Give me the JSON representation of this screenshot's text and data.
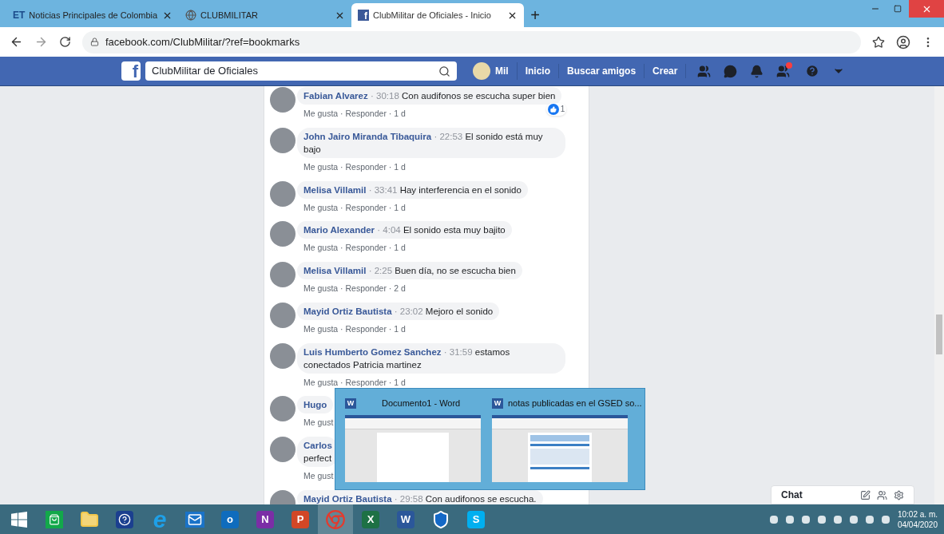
{
  "browser": {
    "tabs": [
      {
        "kind": "letters",
        "favicon": "ET",
        "title": "Noticias Principales de Colombia",
        "selected": false
      },
      {
        "kind": "globe",
        "title": "CLUBMILITAR",
        "selected": false
      },
      {
        "kind": "facebook",
        "favicon": "f",
        "title": "ClubMilitar de Oficiales - Inicio",
        "selected": true
      }
    ],
    "new_tab": "+",
    "address": "facebook.com/ClubMilitar/?ref=bookmarks"
  },
  "facebook_bar": {
    "logo": "f",
    "search": "ClubMilitar de Oficiales",
    "profile": "Mil",
    "links": [
      "Inicio",
      "Buscar amigos",
      "Crear"
    ]
  },
  "comments": [
    {
      "author": "Fabian Alvarez",
      "separator": "·",
      "time": "30:18",
      "text": "Con audifonos se escucha super bien",
      "actions": "Me gusta · Responder · 1 d",
      "likes": "1"
    },
    {
      "author": "John Jairo Miranda Tibaquira",
      "separator": "·",
      "time": "22:53",
      "text": "El sonido está muy bajo",
      "actions": "Me gusta · Responder · 1 d"
    },
    {
      "author": "Melisa Villamil",
      "separator": "·",
      "time": "33:41",
      "text": "Hay interferencia en el sonido",
      "actions": "Me gusta · Responder · 1 d"
    },
    {
      "author": "Mario Alexander",
      "separator": "·",
      "time": "4:04",
      "text": "El sonido esta muy bajito",
      "actions": "Me gusta · Responder · 1 d"
    },
    {
      "author": "Melisa Villamil",
      "separator": "·",
      "time": "2:25",
      "text": "Buen día, no se escucha bien",
      "actions": "Me gusta · Responder · 2 d"
    },
    {
      "author": "Mayid Ortiz Bautista",
      "separator": "·",
      "time": "23:02",
      "text": "Mejoro el sonido",
      "actions": "Me gusta · Responder · 1 d"
    },
    {
      "author": "Luis Humberto Gomez Sanchez",
      "separator": "·",
      "time": "31:59",
      "text": "estamos conectados Patricia martinez",
      "actions": "Me gusta · Responder · 1 d"
    },
    {
      "author": "Hugo",
      "actions": "Me gust"
    },
    {
      "author": "Carlos",
      "text": "perfect",
      "actions": "Me gust"
    },
    {
      "author": "Mayid Ortiz Bautista",
      "separator": "·",
      "time": "29:58",
      "text": "Con audifonos se escucha."
    }
  ],
  "task_preview": [
    {
      "app": "W",
      "title": "Documento1 - Word",
      "kind": "blank"
    },
    {
      "app": "W",
      "title": "notas publicadas en el GSED so...",
      "kind": "document"
    }
  ],
  "chat": {
    "label": "Chat"
  },
  "taskbar": {
    "apps": [
      {
        "kind": "windows"
      },
      {
        "kind": "store"
      },
      {
        "kind": "folder"
      },
      {
        "kind": "help"
      },
      {
        "kind": "ie",
        "letter": "e"
      },
      {
        "kind": "mail"
      },
      {
        "kind": "letter",
        "letter": "o",
        "color": "#0f6cbd"
      },
      {
        "kind": "letter",
        "letter": "N",
        "color": "#7b2ea6"
      },
      {
        "kind": "letter",
        "letter": "P",
        "color": "#d24726"
      },
      {
        "kind": "chrome"
      },
      {
        "kind": "letter",
        "letter": "X",
        "color": "#1e7145"
      },
      {
        "kind": "letter",
        "letter": "W",
        "color": "#2b579a"
      },
      {
        "kind": "shield"
      },
      {
        "kind": "letter",
        "letter": "S",
        "color": "#00aff0"
      }
    ],
    "time": "10:02 a. m.",
    "date": "04/04/2020"
  }
}
